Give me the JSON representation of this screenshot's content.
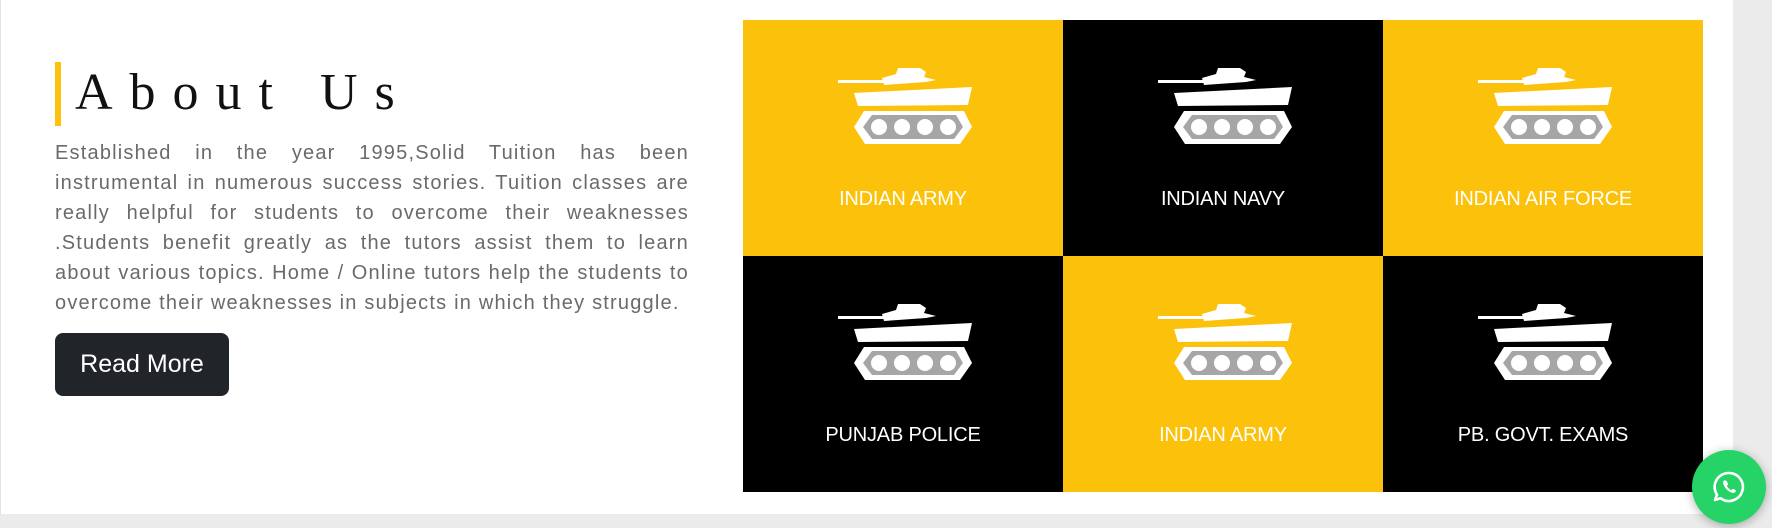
{
  "about": {
    "title": "About Us",
    "description": "Established in the year 1995,Solid Tuition has been instrumental in numerous success stories. Tuition classes are really helpful for students to overcome their weaknesses .Students benefit greatly as the tutors assist them to learn about various topics. Home / Online tutors help the students to overcome their weaknesses in subjects in which they struggle.",
    "read_more_label": "Read More"
  },
  "tiles": [
    {
      "label": "INDIAN ARMY",
      "bg": "#fcc10a",
      "icon": "tank-icon"
    },
    {
      "label": "INDIAN NAVY",
      "bg": "#000000",
      "icon": "tank-icon"
    },
    {
      "label": "INDIAN AIR FORCE",
      "bg": "#fcc10a",
      "icon": "tank-icon"
    },
    {
      "label": "PUNJAB POLICE",
      "bg": "#000000",
      "icon": "tank-icon"
    },
    {
      "label": "INDIAN ARMY",
      "bg": "#fcc10a",
      "icon": "tank-icon"
    },
    {
      "label": "PB. GOVT. EXAMS",
      "bg": "#000000",
      "icon": "tank-icon"
    }
  ],
  "whatsapp": {
    "icon": "whatsapp-icon",
    "color": "#25d366"
  },
  "colors": {
    "accent": "#fcc10a",
    "button": "#212529",
    "text": "#6a6a6a"
  }
}
